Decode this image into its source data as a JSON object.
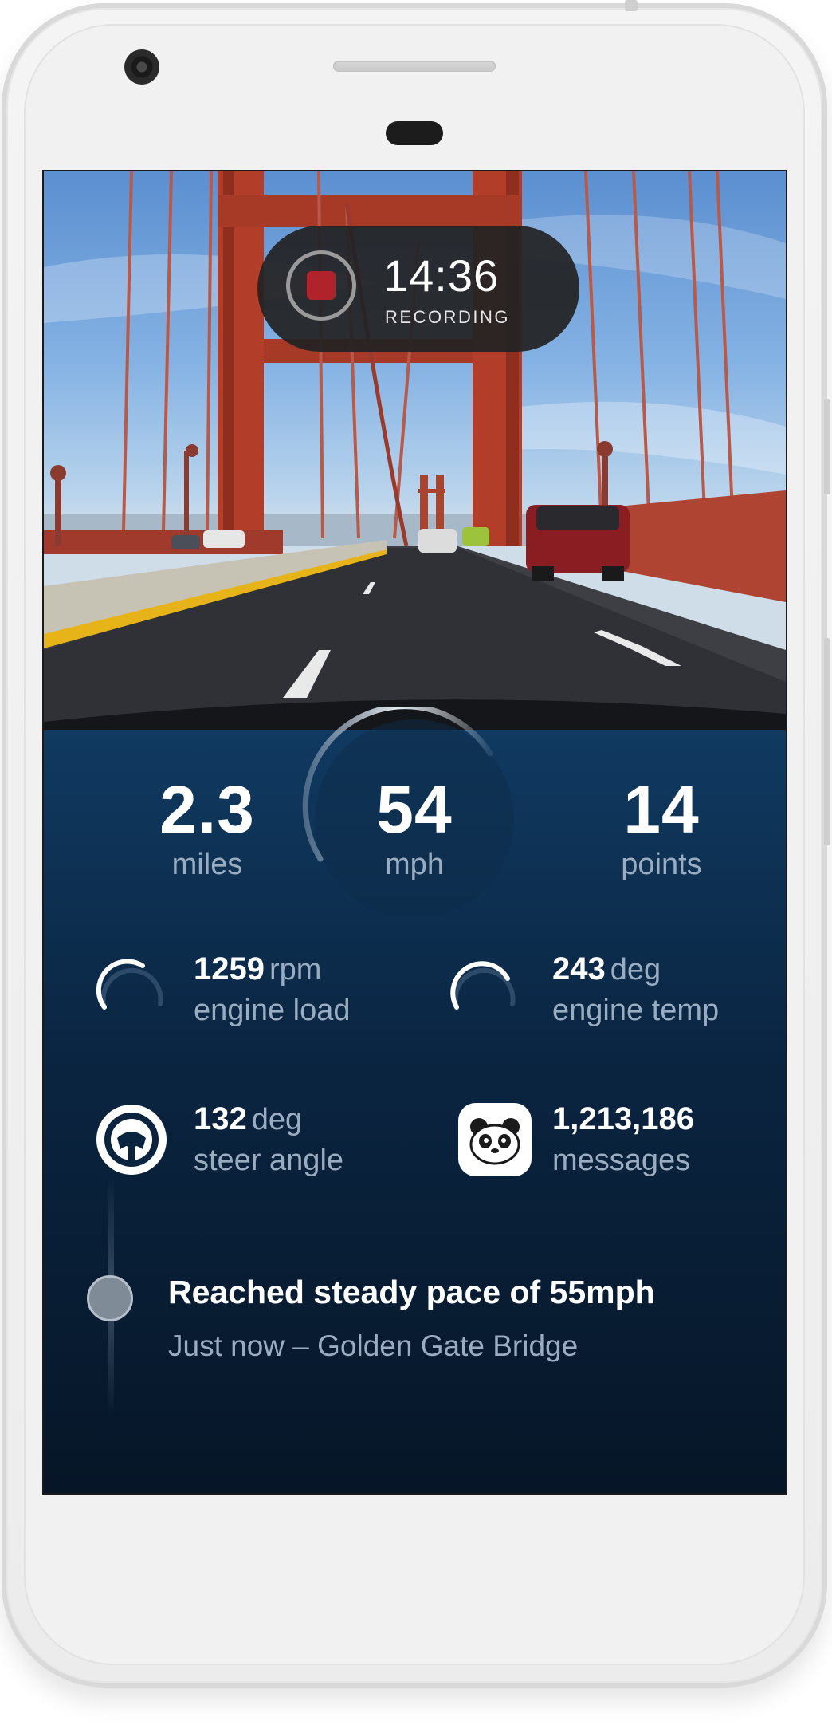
{
  "recording": {
    "time": "14:36",
    "label": "RECORDING",
    "record_color": "#b0232a"
  },
  "stats": {
    "distance": {
      "value": "2.3",
      "unit": "miles"
    },
    "speed": {
      "value": "54",
      "unit": "mph"
    },
    "score": {
      "value": "14",
      "unit": "points"
    }
  },
  "metrics": {
    "engine_load": {
      "value": "1259",
      "unit": "rpm",
      "label": "engine load",
      "icon": "engine-load-gauge-icon"
    },
    "engine_temp": {
      "value": "243",
      "unit": "deg",
      "label": "engine temp",
      "icon": "engine-temp-gauge-icon"
    },
    "steer_angle": {
      "value": "132",
      "unit": "deg",
      "label": "steer angle",
      "icon": "steering-wheel-icon"
    },
    "messages": {
      "value": "1,213,186",
      "label": "messages",
      "icon": "panda-icon"
    }
  },
  "event": {
    "title": "Reached steady pace of 55mph",
    "subtitle": "Just now – Golden Gate Bridge"
  },
  "colors": {
    "dashboard_top": "#103a61",
    "dashboard_bottom": "#061627",
    "muted_text": "#9aacbf",
    "bridge_red": "#b8402e"
  }
}
